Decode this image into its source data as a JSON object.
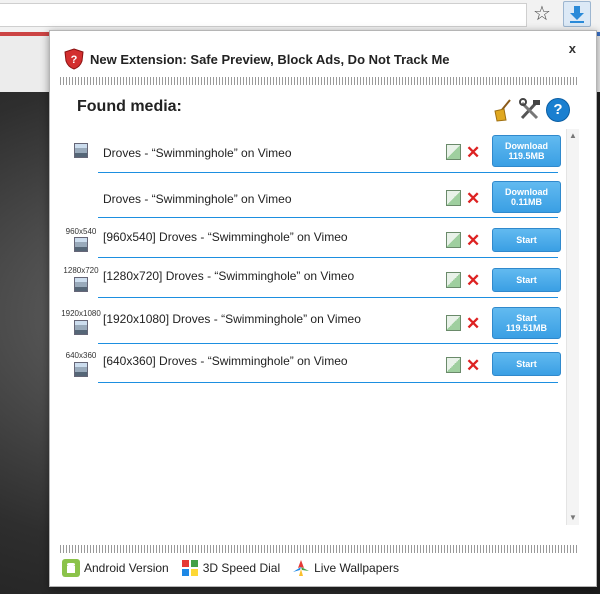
{
  "popup": {
    "close_label": "x",
    "promo_text": "New Extension: Safe Preview, Block Ads, Do Not Track Me",
    "found_media_label": "Found media:",
    "help_label": "?"
  },
  "media": [
    {
      "res": "",
      "title": "Droves - “Swimminghole” on Vimeo",
      "button": [
        "Download",
        "119.5MB"
      ],
      "delete": "✕"
    },
    {
      "res": "",
      "title": "Droves - “Swimminghole” on Vimeo",
      "button": [
        "Download",
        "0.11MB"
      ],
      "delete": "✕"
    },
    {
      "res": "960x540",
      "title": "[960x540] Droves - “Swimminghole” on Vimeo",
      "button": [
        "Start",
        ""
      ],
      "delete": "✕"
    },
    {
      "res": "1280x720",
      "title": "[1280x720] Droves - “Swimminghole” on Vimeo",
      "button": [
        "Start",
        ""
      ],
      "delete": "✕"
    },
    {
      "res": "1920x1080",
      "title": "[1920x1080] Droves - “Swimminghole” on Vimeo",
      "button": [
        "Start",
        "119.51MB"
      ],
      "delete": "✕"
    },
    {
      "res": "640x360",
      "title": "[640x360] Droves - “Swimminghole” on Vimeo",
      "button": [
        "Start",
        ""
      ],
      "delete": "✕"
    }
  ],
  "footer": {
    "android": "Android Version",
    "speed_dial": "3D Speed Dial",
    "wallpapers": "Live Wallpapers"
  },
  "colors": {
    "accent": "#3a9fe4",
    "line": "#1d8fe0",
    "delete": "#dd2222"
  }
}
